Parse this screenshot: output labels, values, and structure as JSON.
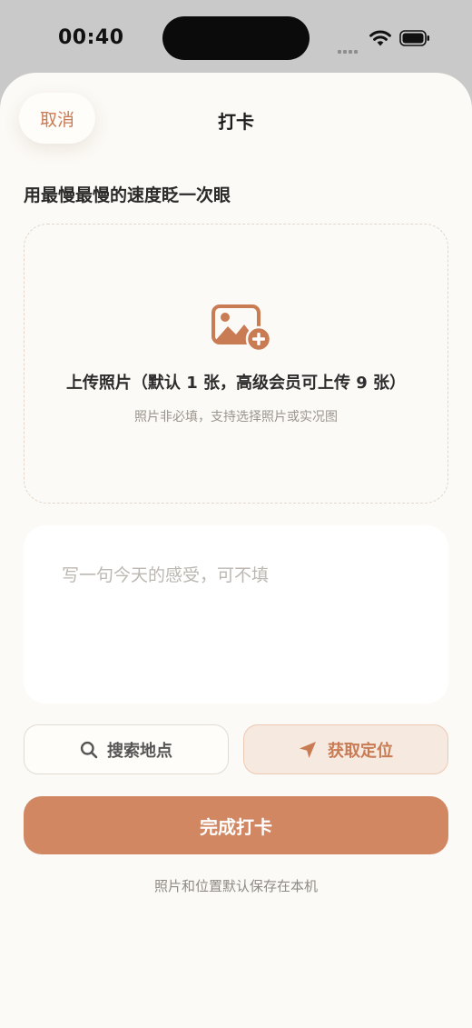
{
  "status_bar": {
    "time": "00:40"
  },
  "header": {
    "cancel_label": "取消",
    "title": "打卡"
  },
  "prompt_text": "用最慢最慢的速度眨一次眼",
  "upload": {
    "title": "上传照片（默认 1 张，高级会员可上传 9 张）",
    "hint": "照片非必填，支持选择照片或实况图"
  },
  "note": {
    "placeholder": "写一句今天的感受，可不填"
  },
  "location": {
    "search_label": "搜索地点",
    "locate_label": "获取定位"
  },
  "submit_label": "完成打卡",
  "footer_note": "照片和位置默认保存在本机",
  "colors": {
    "accent": "#c97b54",
    "primary_button": "#d08762",
    "sheet_background": "#fcfaf6"
  },
  "icons": {
    "upload": "image-add-icon",
    "search": "search-icon",
    "locate": "navigation-arrow-icon"
  }
}
